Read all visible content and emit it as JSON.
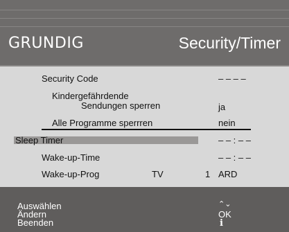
{
  "header": {
    "brand": "GRUNDIG",
    "title": "Security/Timer"
  },
  "menu": {
    "security_code": {
      "label": "Security Code",
      "value": "– – – –"
    },
    "child_block": {
      "label_line1": "Kindergefährdende",
      "label_line2": "Sendungen sperren",
      "value": "ja"
    },
    "lock_all": {
      "label": "Alle Programme sperrren",
      "value": "nein"
    },
    "sleep_timer": {
      "label": "Sleep Timer",
      "value": "– – : – –"
    },
    "wake_time": {
      "label": "Wake-up-Time",
      "value": "– – : – –"
    },
    "wake_prog": {
      "label": "Wake-up-Prog",
      "source": "TV",
      "number": "1",
      "channel": "ARD"
    }
  },
  "footer": {
    "select_label": "Auswählen",
    "change_label": "Ändern",
    "exit_label": "Beenden",
    "select_key": "⌃⌄",
    "change_key": "OK",
    "exit_key": "i"
  }
}
